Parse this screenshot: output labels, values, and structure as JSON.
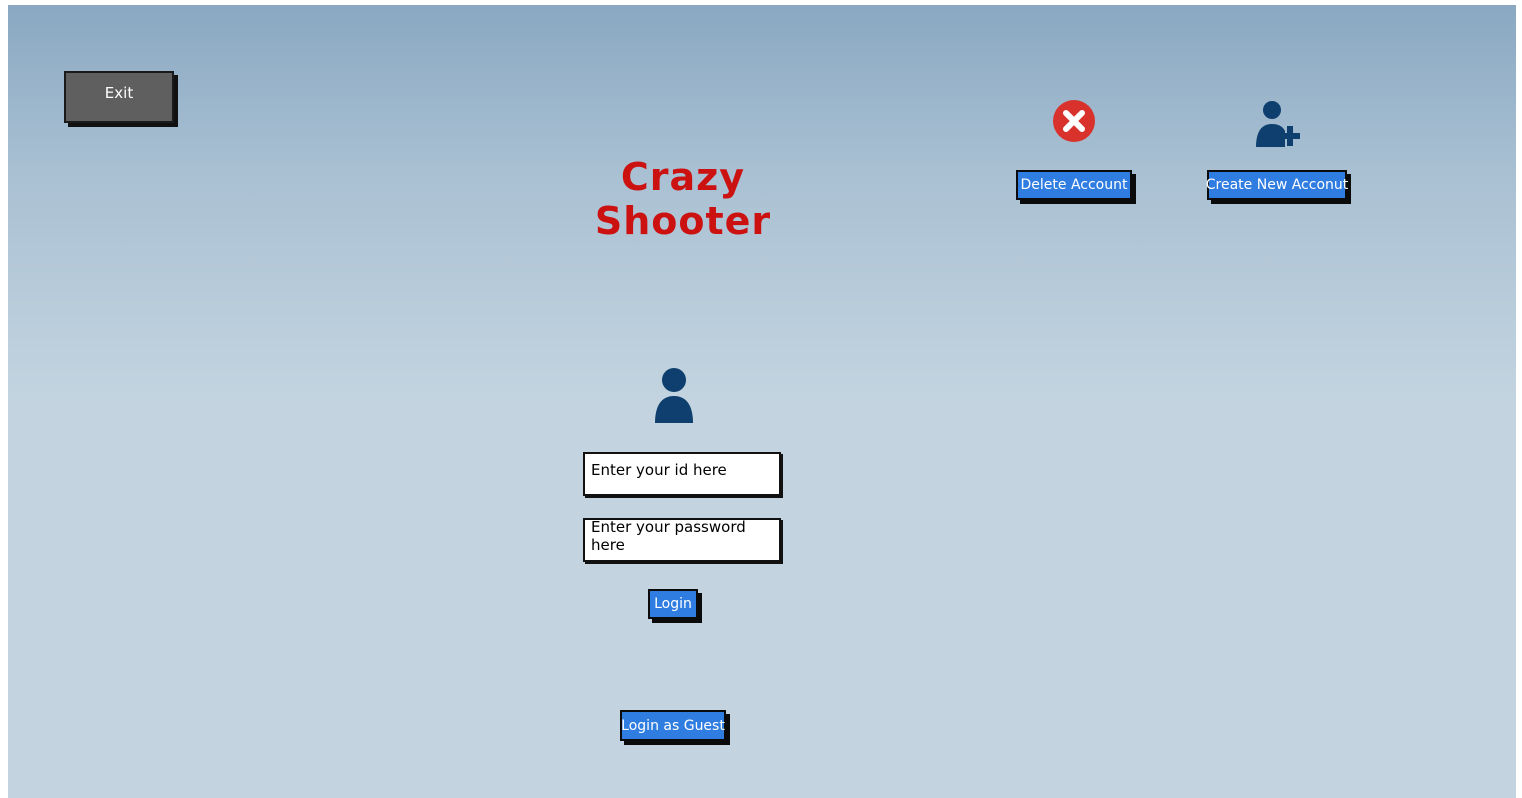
{
  "header": {
    "exit_label": "Exit",
    "title": "Crazy Shooter"
  },
  "account_actions": {
    "delete_label": "Delete Account",
    "delete_icon": "delete-x-circle-icon",
    "create_label": "Create New Acconut",
    "create_icon": "add-user-icon"
  },
  "login_form": {
    "user_icon": "user-icon",
    "id_placeholder": "Enter your id here",
    "password_placeholder": "Enter your password here",
    "login_label": "Login",
    "guest_label": "Login as Guest"
  },
  "colors": {
    "title": "#cc1111",
    "button_blue": "#2f7de1",
    "icon_navy": "#0e3f6e",
    "delete_red": "#d9322c",
    "exit_gray": "#5f5f5f"
  }
}
